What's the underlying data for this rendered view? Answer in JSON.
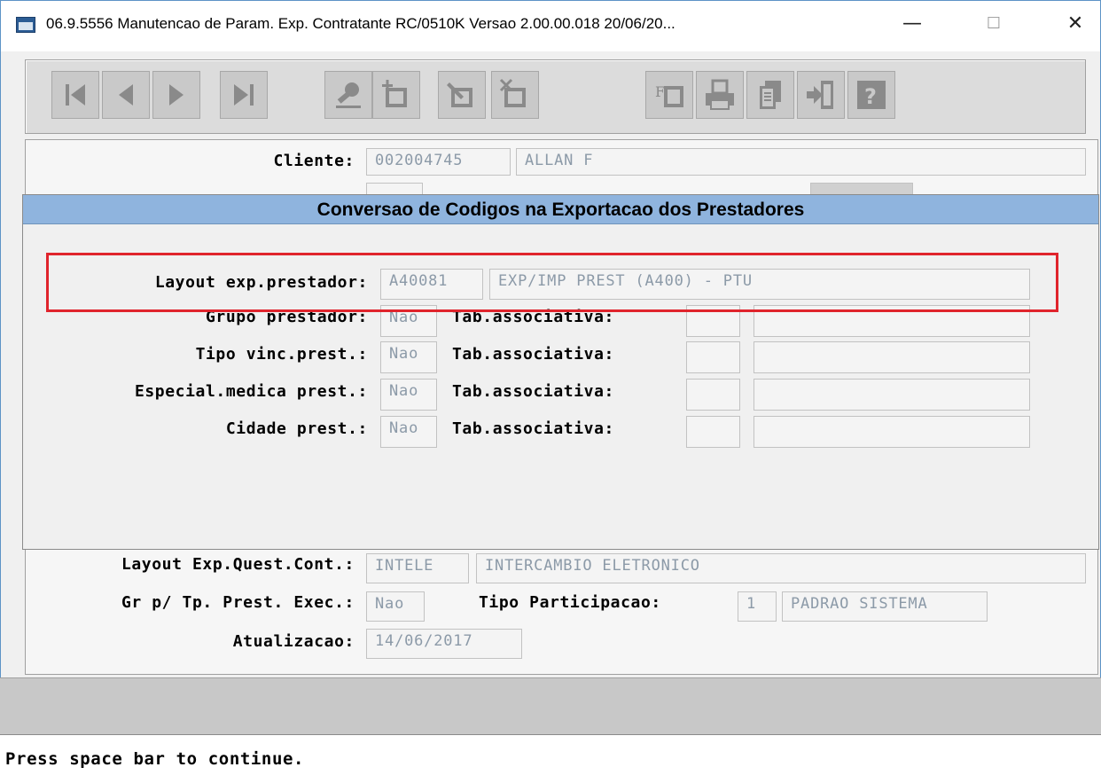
{
  "window": {
    "title": "06.9.5556 Manutencao  de Param. Exp. Contratante RC/0510K Versao 2.00.00.018 20/06/20...",
    "minimize_glyph": "—",
    "maximize_glyph": "☐",
    "close_glyph": "✕"
  },
  "toolbar": {
    "icons": [
      "first-record-icon",
      "previous-record-icon",
      "next-record-icon",
      "last-record-icon",
      "search-key-icon",
      "add-record-icon",
      "edit-record-icon",
      "delete-record-icon",
      "filter-icon",
      "print-icon",
      "copy-icon",
      "exit-icon",
      "help-icon"
    ]
  },
  "form": {
    "cliente_label": "Cliente:",
    "cliente_code": "002004745",
    "cliente_name": "ALLAN F",
    "layout_quest_label": "Layout Exp.Quest.Cont.:",
    "layout_quest_code": "INTELE",
    "layout_quest_desc": "INTERCAMBIO ELETRONICO",
    "gr_tp_label": "Gr p/ Tp. Prest. Exec.:",
    "gr_tp_value": "Nao",
    "tipo_part_label": "Tipo Participacao:",
    "tipo_part_code": "1",
    "tipo_part_desc": "PADRAO SISTEMA",
    "atualizacao_label": "Atualizacao:",
    "atualizacao_value": "14/06/2017"
  },
  "dialog": {
    "title": "Conversao de Codigos na Exportacao dos Prestadores",
    "layout_label": "Layout exp.prestador:",
    "layout_code": "A40081",
    "layout_desc": "EXP/IMP PREST (A400) - PTU",
    "rows": [
      {
        "label": "Grupo prestador:",
        "value": "Nao",
        "tab_label": "Tab.associativa:",
        "tab_code": "",
        "tab_desc": ""
      },
      {
        "label": "Tipo vinc.prest.:",
        "value": "Nao",
        "tab_label": "Tab.associativa:",
        "tab_code": "",
        "tab_desc": ""
      },
      {
        "label": "Especial.medica prest.:",
        "value": "Nao",
        "tab_label": "Tab.associativa:",
        "tab_code": "",
        "tab_desc": ""
      },
      {
        "label": "Cidade prest.:",
        "value": "Nao",
        "tab_label": "Tab.associativa:",
        "tab_code": "",
        "tab_desc": ""
      }
    ]
  },
  "status": {
    "message": "Press space bar to continue."
  },
  "colors": {
    "dialog_title_bg": "#8fb4de",
    "highlight_border": "#e0242c",
    "field_text": "#8c9aa8"
  }
}
